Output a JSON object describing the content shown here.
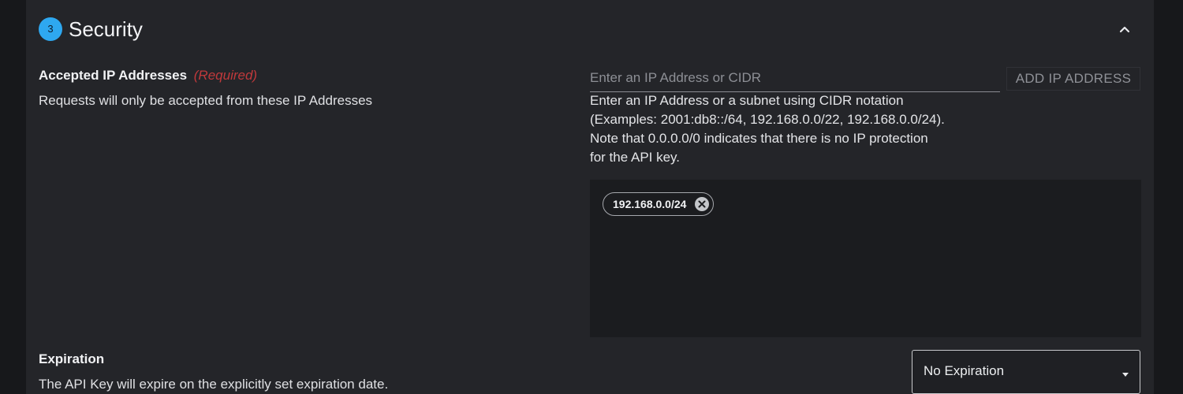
{
  "security_section": {
    "step_number": "3",
    "title": "Security",
    "collapse_icon": "chevron-up-icon"
  },
  "accepted_ips": {
    "label": "Accepted IP Addresses",
    "required_text": "(Required)",
    "description": "Requests will only be accepted from these IP Addresses",
    "input_placeholder": "Enter an IP Address or CIDR",
    "input_value": "",
    "add_button_label": "ADD IP ADDRESS",
    "help_lines": [
      "Enter an IP Address or a subnet using CIDR notation",
      "(Examples: 2001:db8::/64, 192.168.0.0/22, 192.168.0.0/24).",
      "Note that 0.0.0.0/0 indicates that there is no IP protection",
      "for the API key."
    ],
    "entries": [
      {
        "value": "192.168.0.0/24",
        "remove_icon": "close-circle-icon"
      }
    ]
  },
  "expiration": {
    "label": "Expiration",
    "description": "The API Key will expire on the explicitly set expiration date.",
    "selected_value": "No Expiration",
    "caret_icon": "caret-down-icon"
  },
  "colors": {
    "accent": "#2ea8f0",
    "required": "#c0393b",
    "panel_bg": "#242529",
    "page_bg": "#17181b"
  }
}
